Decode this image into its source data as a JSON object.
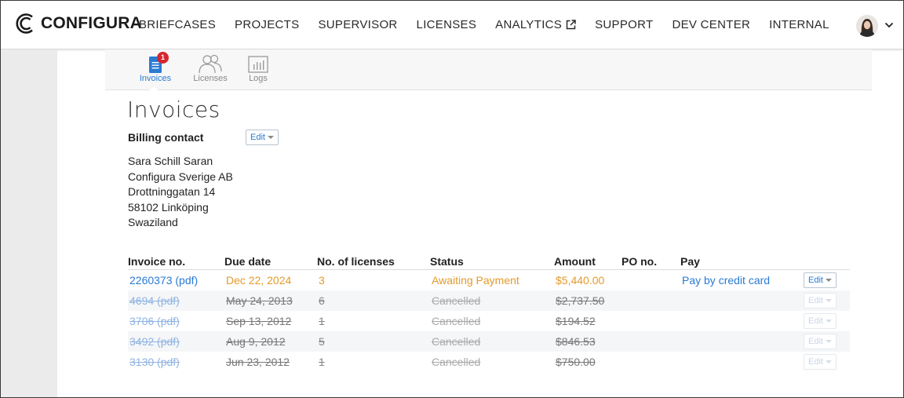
{
  "brand": {
    "name": "CONFIGURA"
  },
  "nav": [
    {
      "label": "BRIEFCASES"
    },
    {
      "label": "PROJECTS"
    },
    {
      "label": "SUPERVISOR"
    },
    {
      "label": "LICENSES"
    },
    {
      "label": "ANALYTICS",
      "icon": "external-link-icon"
    },
    {
      "label": "SUPPORT"
    },
    {
      "label": "DEV CENTER"
    },
    {
      "label": "INTERNAL"
    }
  ],
  "tabs": [
    {
      "label": "Invoices",
      "badge": "1",
      "icon": "invoice-icon",
      "active": true
    },
    {
      "label": "Licenses",
      "icon": "users-icon"
    },
    {
      "label": "Logs",
      "icon": "bar-chart-icon"
    }
  ],
  "page": {
    "title": "Invoices",
    "billing_label": "Billing contact",
    "edit_label": "Edit",
    "address": [
      "Sara Schill Saran",
      "Configura Sverige AB",
      "Drottninggatan 14",
      "58102 Linköping",
      "Swaziland"
    ]
  },
  "table": {
    "headers": [
      "Invoice no.",
      "Due date",
      "No. of licenses",
      "Status",
      "Amount",
      "PO no.",
      "Pay"
    ],
    "rows": [
      {
        "invoice": "2260373 (pdf)",
        "due": "Dec 22, 2024",
        "licenses": "3",
        "status": "Awaiting Payment",
        "amount": "$5,440.00",
        "po": "",
        "pay": "Pay by credit card",
        "edit": "Edit"
      },
      {
        "invoice": "4694 (pdf)",
        "due": "May 24, 2013",
        "licenses": "6",
        "status": "Cancelled",
        "amount": "$2,737.50",
        "po": "",
        "pay": "",
        "edit": "Edit"
      },
      {
        "invoice": "3706 (pdf)",
        "due": "Sep 13, 2012",
        "licenses": "1",
        "status": "Cancelled",
        "amount": "$194.52",
        "po": "",
        "pay": "",
        "edit": "Edit"
      },
      {
        "invoice": "3492 (pdf)",
        "due": "Aug 9, 2012",
        "licenses": "5",
        "status": "Cancelled",
        "amount": "$846.53",
        "po": "",
        "pay": "",
        "edit": "Edit"
      },
      {
        "invoice": "3130 (pdf)",
        "due": "Jun 23, 2012",
        "licenses": "1",
        "status": "Cancelled",
        "amount": "$750.00",
        "po": "",
        "pay": "",
        "edit": "Edit"
      }
    ]
  },
  "colors": {
    "link": "#2a7ad3",
    "pending": "#e39a2b",
    "badge": "#d7262e"
  }
}
